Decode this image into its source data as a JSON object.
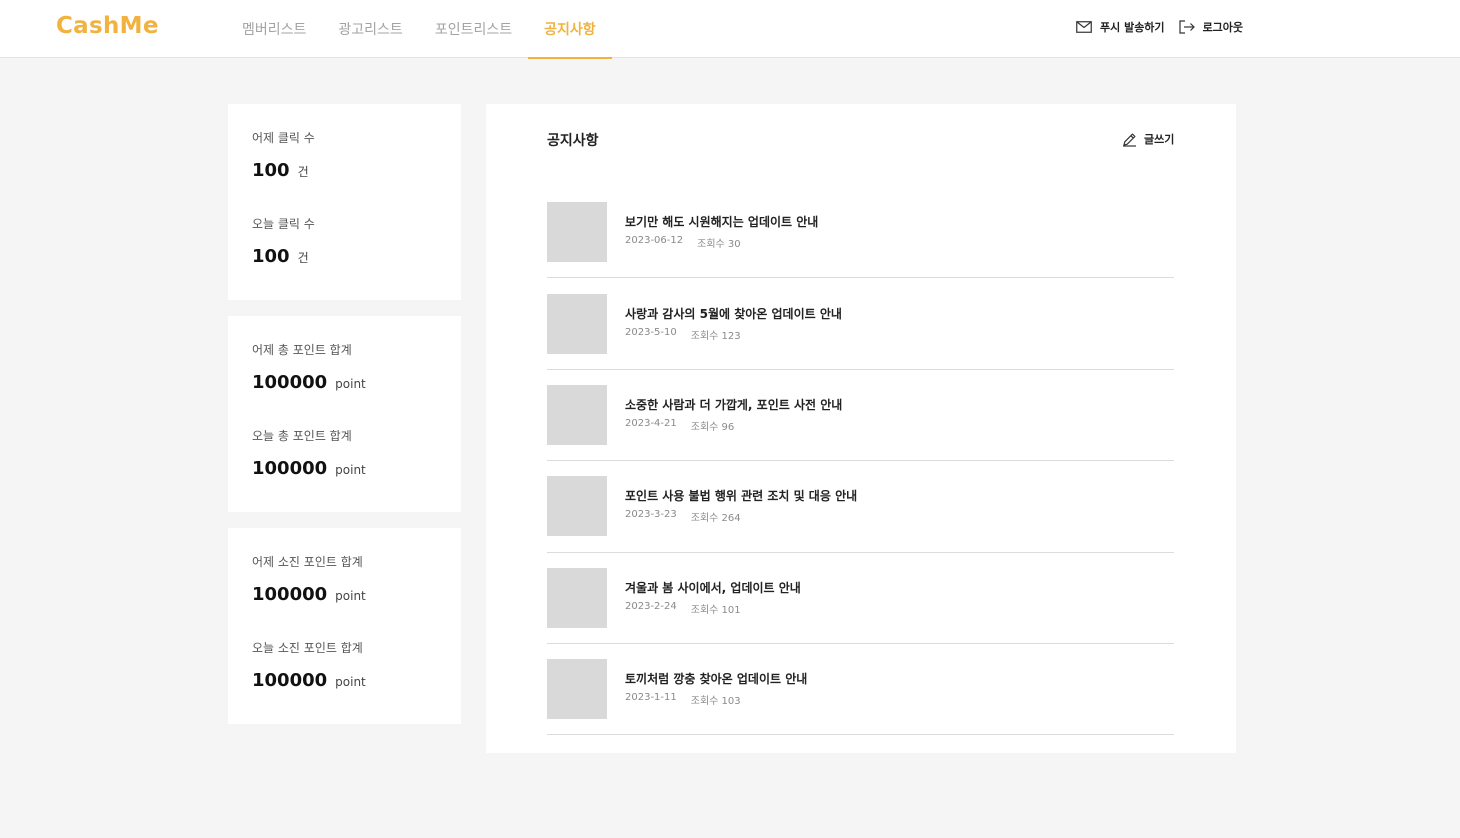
{
  "header": {
    "logo": "CashMe",
    "nav": [
      "멤버리스트",
      "광고리스트",
      "포인트리스트",
      "공지사항"
    ],
    "active_nav": 3,
    "push_label": "푸시 발송하기",
    "logout_label": "로그아웃"
  },
  "stats": {
    "cards": [
      {
        "items": [
          {
            "label": "어제 클릭 수",
            "value": "100",
            "unit": "건"
          },
          {
            "label": "오늘 클릭 수",
            "value": "100",
            "unit": "건"
          }
        ]
      },
      {
        "items": [
          {
            "label": "어제 총 포인트 합계",
            "value": "100000",
            "unit": "point"
          },
          {
            "label": "오늘 총 포인트 합계",
            "value": "100000",
            "unit": "point"
          }
        ]
      },
      {
        "items": [
          {
            "label": "어제 소진 포인트 합계",
            "value": "100000",
            "unit": "point"
          },
          {
            "label": "오늘 소진 포인트 합계",
            "value": "100000",
            "unit": "point"
          }
        ]
      }
    ]
  },
  "notices": {
    "title": "공지사항",
    "write_label": "글쓰기",
    "items": [
      {
        "title": "보기만 해도 시원해지는 업데이트 안내",
        "date": "2023-06-12",
        "views": "조회수 30"
      },
      {
        "title": "사랑과 감사의 5월에 찾아온 업데이트 안내",
        "date": "2023-5-10",
        "views": "조회수 123"
      },
      {
        "title": "소중한 사람과 더 가깝게, 포인트 사전 안내",
        "date": "2023-4-21",
        "views": "조회수 96"
      },
      {
        "title": "포인트 사용 불법 행위 관련 조치 및 대응 안내",
        "date": "2023-3-23",
        "views": "조회수 264"
      },
      {
        "title": "겨울과 봄 사이에서, 업데이트 안내",
        "date": "2023-2-24",
        "views": "조회수 101"
      },
      {
        "title": "토끼처럼 깡충 찾아온 업데이트 안내",
        "date": "2023-1-11",
        "views": "조회수 103"
      }
    ]
  },
  "colors": {
    "accent": "#f1b240",
    "background": "#f5f5f5",
    "thumbnail": "#d9d9d9"
  },
  "icons": {
    "push": "mail-icon",
    "logout": "logout-icon",
    "write": "pencil-icon"
  }
}
